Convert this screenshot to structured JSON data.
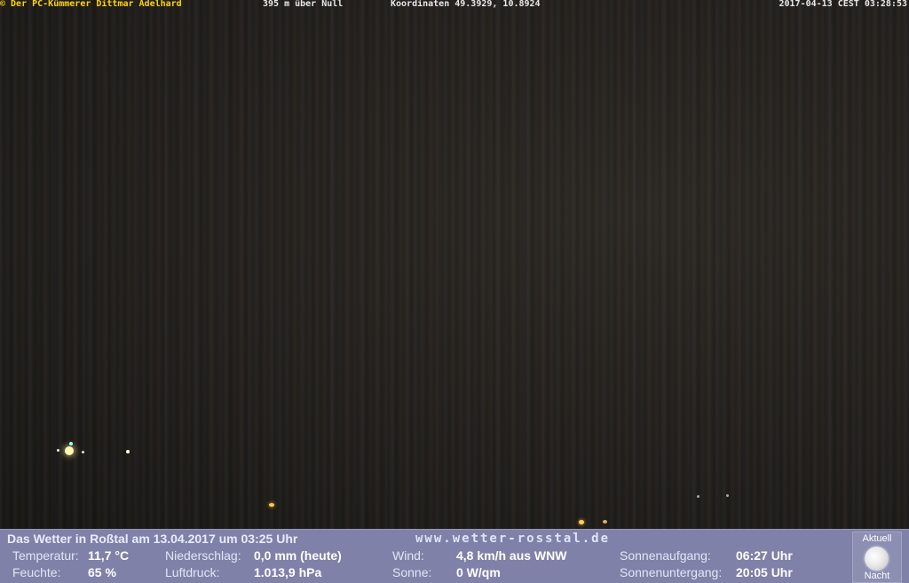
{
  "overlay": {
    "credit": "© Der PC-Kümmerer Dittmar Adelhard",
    "altitude": "395 m über Null",
    "coords": "Koordinaten 49.3929, 10.8924",
    "timestamp": "2017-04-13 CEST 03:28:53"
  },
  "weather": {
    "title": "Das Wetter in Roßtal am 13.04.2017 um 03:25 Uhr",
    "url": "www.wetter-rosstal.de",
    "temperature_label": "Temperatur:",
    "temperature_value": "11,7 °C",
    "humidity_label": "Feuchte:",
    "humidity_value": "65 %",
    "precip_label": "Niederschlag:",
    "precip_value": "0,0 mm (heute)",
    "pressure_label": "Luftdruck:",
    "pressure_value": "1.013,9 hPa",
    "wind_label": "Wind:",
    "wind_value": "4,8 km/h aus WNW",
    "sun_label": "Sonne:",
    "sun_value": "0 W/qm",
    "sunrise_label": "Sonnenaufgang:",
    "sunrise_value": "06:27 Uhr",
    "sunset_label": "Sonnenuntergang:",
    "sunset_value": "20:05 Uhr",
    "moon_top": "Aktuell",
    "moon_bottom": "Nacht",
    "moon_icon": "full-moon-icon"
  },
  "colors": {
    "credit": "#ffd40a",
    "bar_background": "#7f81a8"
  }
}
